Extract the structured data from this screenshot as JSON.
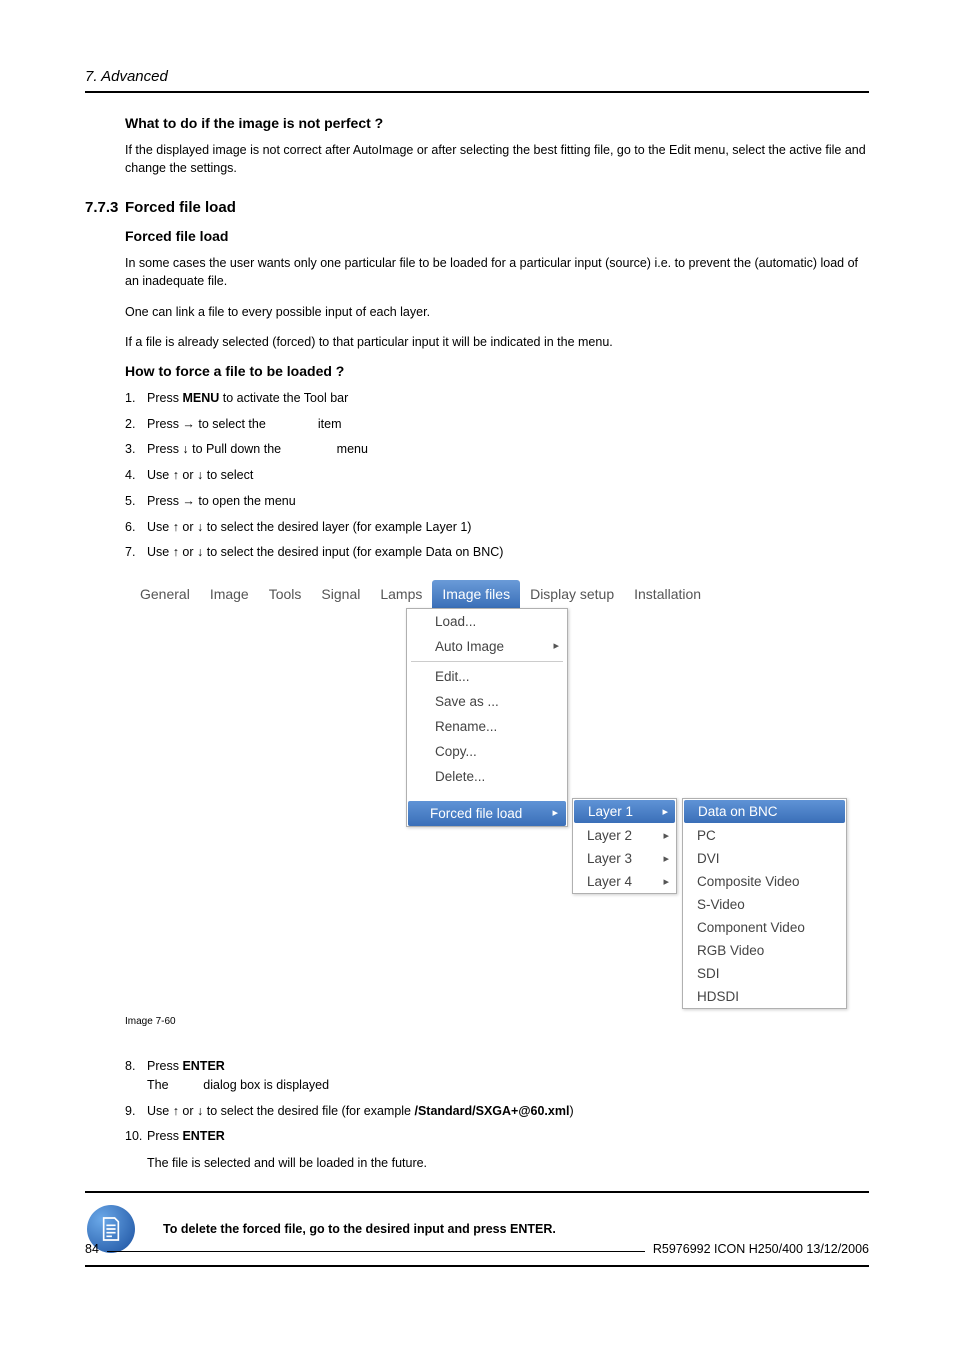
{
  "header": {
    "chapter": "7. Advanced"
  },
  "s1": {
    "h": "What to do if the image is not perfect ?",
    "p": "If the displayed image is not correct after AutoImage or after selecting the best fitting file, go to the Edit menu, select the active file and change the settings."
  },
  "sec": {
    "num": "7.7.3",
    "title": "Forced file load"
  },
  "s2": {
    "h": "Forced file load",
    "p1": "In some cases the user wants only one particular file to be loaded for a particular input (source) i.e. to prevent the (automatic) load of an inadequate file.",
    "p2": "One can link a file to every possible input of each layer.",
    "p3": "If a file is already selected (forced) to that particular input it will be indicated in the menu."
  },
  "s3": {
    "h": "How to force a file to be loaded ?",
    "steps": [
      {
        "n": "1.",
        "pre": "Press ",
        "b": "MENU",
        "post": " to activate the Tool bar"
      },
      {
        "n": "2.",
        "pre": "Press → to select the ",
        "gap": "              ",
        "post": "item"
      },
      {
        "n": "3.",
        "pre": "Press ↓ to Pull down the ",
        "gap": "               ",
        "post": "menu"
      },
      {
        "n": "4.",
        "pre": "Use ↑ or ↓ to select"
      },
      {
        "n": "5.",
        "pre": "Press → to open the menu"
      },
      {
        "n": "6.",
        "pre": "Use ↑ or ↓ to select the desired layer (for example Layer 1)"
      },
      {
        "n": "7.",
        "pre": "Use ↑ or ↓ to select the desired input (for example Data on BNC)"
      }
    ]
  },
  "menu": {
    "bar": [
      "General",
      "Image",
      "Tools",
      "Signal",
      "Lamps",
      "Image files",
      "Display setup",
      "Installation"
    ],
    "dd": [
      {
        "t": "Load..."
      },
      {
        "t": "Auto Image",
        "sub": true
      },
      {
        "sep": true
      },
      {
        "t": "Edit..."
      },
      {
        "t": "Save as ..."
      },
      {
        "t": "Rename..."
      },
      {
        "t": "Copy..."
      },
      {
        "t": "Delete..."
      },
      {
        "gap": true
      },
      {
        "t": "Forced file load",
        "sub": true,
        "hi": true
      }
    ],
    "dd2": [
      {
        "t": "Layer 1",
        "hi": true
      },
      {
        "t": "Layer 2"
      },
      {
        "t": "Layer 3"
      },
      {
        "t": "Layer 4"
      }
    ],
    "dd3": [
      {
        "t": "Data on BNC",
        "hi": true
      },
      {
        "t": "PC"
      },
      {
        "t": "DVI"
      },
      {
        "t": "Composite Video"
      },
      {
        "t": "S-Video"
      },
      {
        "t": "Component Video"
      },
      {
        "t": "RGB Video"
      },
      {
        "t": "SDI"
      },
      {
        "t": "HDSDI"
      }
    ]
  },
  "caption": "Image 7-60",
  "s4": {
    "steps": [
      {
        "n": "8.",
        "pre": "Press ",
        "b": "ENTER",
        "line2pre": "The ",
        "line2gap": "         ",
        "line2post": "dialog box is displayed"
      },
      {
        "n": "9.",
        "pre": "Use ↑ or ↓ to select the desired file (for example ",
        "b": "/Standard/SXGA+@60.xml",
        "post": ")"
      },
      {
        "n": "10.",
        "pre": "Press ",
        "b": "ENTER",
        "line2": "The file is selected and will be loaded in the future."
      }
    ]
  },
  "note": "To delete the forced file, go to the desired input and press ENTER.",
  "footer": {
    "page": "84",
    "doc": "R5976992  ICON H250/400  13/12/2006"
  }
}
